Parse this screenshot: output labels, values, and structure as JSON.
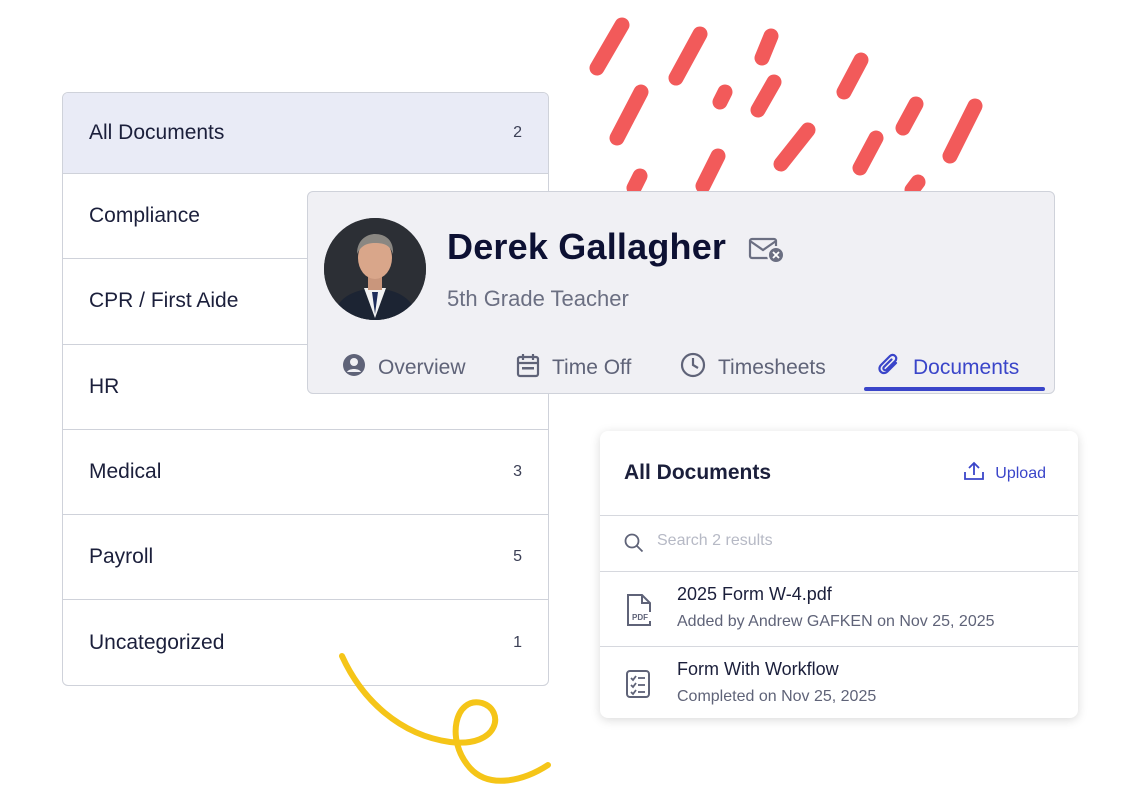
{
  "categories": [
    {
      "label": "All Documents",
      "count": "2"
    },
    {
      "label": "Compliance",
      "count": ""
    },
    {
      "label": "CPR / First Aide",
      "count": ""
    },
    {
      "label": "HR",
      "count": ""
    },
    {
      "label": "Medical",
      "count": "3"
    },
    {
      "label": "Payroll",
      "count": "5"
    },
    {
      "label": "Uncategorized",
      "count": "1"
    }
  ],
  "profile": {
    "name": "Derek Gallagher",
    "title": "5th Grade Teacher",
    "status_icon": "mail-blocked-icon",
    "tabs": [
      {
        "label": "Overview",
        "icon": "user-circle-icon"
      },
      {
        "label": "Time Off",
        "icon": "calendar-icon"
      },
      {
        "label": "Timesheets",
        "icon": "clock-icon"
      },
      {
        "label": "Documents",
        "icon": "paperclip-icon"
      }
    ],
    "active_tab": "Documents"
  },
  "documents": {
    "title": "All Documents",
    "upload_label": "Upload",
    "search_placeholder": "Search 2 results",
    "items": [
      {
        "name": "2025 Form W-4.pdf",
        "meta": "Added by Andrew GAFKEN on Nov 25, 2025",
        "icon": "pdf-file-icon"
      },
      {
        "name": "Form With Workflow",
        "meta": "Completed on Nov 25, 2025",
        "icon": "checklist-icon"
      }
    ]
  },
  "colors": {
    "accent": "#3a45c9",
    "active_row": "#e9ebf6",
    "decor_red": "#f25a5a",
    "decor_yellow": "#f5c518"
  }
}
